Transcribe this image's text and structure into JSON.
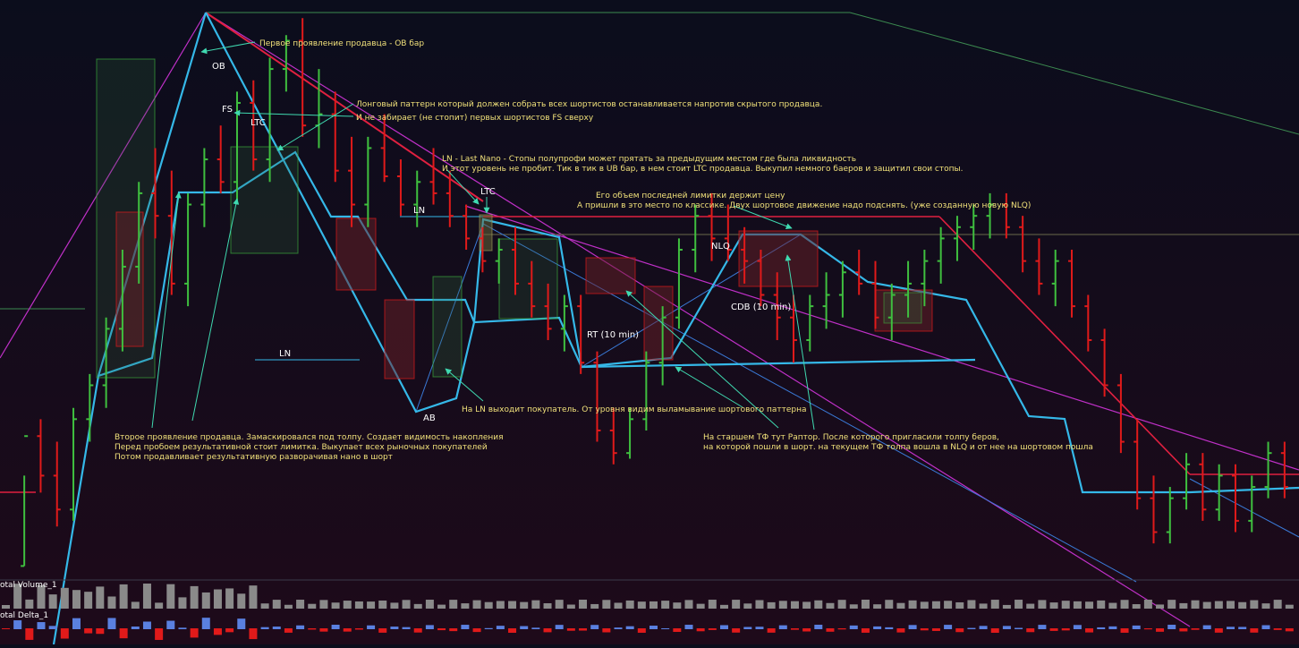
{
  "colors": {
    "background_top": "#0b0d1c",
    "background_bottom": "#1e0a1a",
    "bull": "#3fbf3f",
    "bear": "#e01a1a",
    "cyan": "#35b8e8",
    "magenta": "#c030c8",
    "red_line": "#e02040",
    "green_line": "#3c8a50",
    "annotation_text": "#f0e07a",
    "label_text": "#ffffff",
    "arrow": "#3fd9b0",
    "zone_green": "#2f6a3a",
    "zone_red": "#6a1f28"
  },
  "indicators": {
    "volume_label": "otal Volume_1",
    "delta_label": "otal Delta_1"
  },
  "labels": {
    "ob": "OB",
    "fs": "FS",
    "ltc1": "LTC",
    "ltc2": "LTC",
    "ln1": "LN",
    "ln2": "LN",
    "ab": "AB",
    "rt": "RT (10 min)",
    "nlq": "NLQ",
    "cdb": "CDB (10 min)"
  },
  "annotations": {
    "ob_note": "Первое проявление продавца - OB бар",
    "long_pattern_1": "Лонговый паттерн который должен собрать всех шортистов останавливается напротив скрытого продавца.",
    "long_pattern_2": "И не забирает (не стопит) первых шортистов FS сверху",
    "ln_note_1": "LN - Last Nano - Стопы полупрофи может прятать за предыдущим местом где была ликвидность",
    "ln_note_2": "И этот уровень не пробит. Тик в тик в UB бар, в нем стоит LTC продавца. Выкупил немного баеров и защитил свои стопы.",
    "limit_note_1": "Его объем последней лимитки держит цену",
    "limit_note_2": "А пришли в это место по классике. Двух шортовое движение надо подснять. (уже созданную новую NLQ)",
    "second_seller_1": "Второе проявление продавца. Замаскировался под толпу. Создает видимость накопления",
    "second_seller_2": "Перед пробоем результативной стоит лимитка. Выкупает всех рыночных покупателей",
    "second_seller_3": "Потом продавливает результативную разворачивая нано в шорт",
    "ln_buyer": "На LN выходит покупатель. От уровня видим выламывание шортового паттерна",
    "senior_tf_1": "На старшем ТФ тут Раптор. После которого пригласили толпу беров,",
    "senior_tf_2": "на которой пошли в шорт. на текущем ТФ толпа вошла в NLQ и от нее на шортовом пошла"
  },
  "chart_data": {
    "type": "ohlc",
    "title": "",
    "xlabel": "",
    "ylabel": "",
    "ylim": [
      0,
      100
    ],
    "grid": false,
    "bars": [
      [
        2,
        18,
        2,
        25
      ],
      [
        25,
        28,
        15,
        18
      ],
      [
        18,
        24,
        9,
        12
      ],
      [
        12,
        30,
        10,
        28
      ],
      [
        28,
        36,
        24,
        34
      ],
      [
        34,
        46,
        30,
        44
      ],
      [
        44,
        58,
        40,
        55
      ],
      [
        55,
        70,
        52,
        68
      ],
      [
        68,
        76,
        60,
        64
      ],
      [
        64,
        72,
        50,
        52
      ],
      [
        52,
        68,
        48,
        66
      ],
      [
        66,
        76,
        62,
        74
      ],
      [
        74,
        80,
        68,
        70
      ],
      [
        70,
        86,
        66,
        84
      ],
      [
        84,
        88,
        72,
        74
      ],
      [
        74,
        92,
        70,
        90
      ],
      [
        90,
        96,
        86,
        95
      ],
      [
        95,
        99,
        78,
        80
      ],
      [
        80,
        90,
        76,
        82
      ],
      [
        82,
        86,
        70,
        72
      ],
      [
        72,
        78,
        62,
        66
      ],
      [
        66,
        78,
        62,
        76
      ],
      [
        76,
        82,
        70,
        71
      ],
      [
        71,
        74,
        64,
        66
      ],
      [
        66,
        72,
        62,
        70
      ],
      [
        70,
        76,
        66,
        68
      ],
      [
        68,
        72,
        62,
        64
      ],
      [
        64,
        66,
        58,
        60
      ],
      [
        60,
        62,
        54,
        56
      ],
      [
        56,
        60,
        52,
        58
      ],
      [
        58,
        62,
        50,
        52
      ],
      [
        52,
        56,
        46,
        48
      ],
      [
        48,
        52,
        42,
        44
      ],
      [
        44,
        50,
        40,
        48
      ],
      [
        48,
        50,
        36,
        38
      ],
      [
        38,
        40,
        24,
        26
      ],
      [
        26,
        30,
        20,
        22
      ],
      [
        22,
        30,
        21,
        28
      ],
      [
        28,
        40,
        26,
        38
      ],
      [
        38,
        48,
        34,
        46
      ],
      [
        46,
        60,
        44,
        58
      ],
      [
        58,
        66,
        54,
        64
      ],
      [
        64,
        68,
        56,
        60
      ],
      [
        60,
        66,
        56,
        58
      ],
      [
        58,
        62,
        52,
        56
      ],
      [
        56,
        58,
        48,
        50
      ],
      [
        50,
        54,
        42,
        46
      ],
      [
        46,
        50,
        38,
        42
      ],
      [
        42,
        50,
        40,
        48
      ],
      [
        48,
        54,
        44,
        50
      ],
      [
        50,
        56,
        46,
        54
      ],
      [
        54,
        58,
        50,
        52
      ],
      [
        52,
        56,
        44,
        46
      ],
      [
        46,
        52,
        42,
        50
      ],
      [
        50,
        56,
        46,
        52
      ],
      [
        52,
        58,
        48,
        56
      ],
      [
        56,
        62,
        52,
        60
      ],
      [
        60,
        64,
        56,
        62
      ],
      [
        62,
        66,
        58,
        64
      ],
      [
        64,
        68,
        60,
        66
      ],
      [
        66,
        68,
        60,
        62
      ],
      [
        62,
        64,
        54,
        56
      ],
      [
        56,
        60,
        50,
        52
      ],
      [
        52,
        58,
        48,
        56
      ],
      [
        56,
        58,
        46,
        48
      ],
      [
        48,
        50,
        40,
        42
      ],
      [
        42,
        44,
        32,
        34
      ],
      [
        34,
        36,
        22,
        24
      ],
      [
        24,
        28,
        12,
        14
      ],
      [
        14,
        18,
        6,
        8
      ],
      [
        8,
        16,
        6,
        14
      ],
      [
        14,
        22,
        12,
        20
      ],
      [
        20,
        22,
        10,
        12
      ],
      [
        12,
        20,
        10,
        18
      ],
      [
        18,
        20,
        8,
        10
      ],
      [
        10,
        18,
        8,
        16
      ],
      [
        16,
        24,
        14,
        22
      ],
      [
        22,
        24,
        14,
        16
      ]
    ]
  }
}
